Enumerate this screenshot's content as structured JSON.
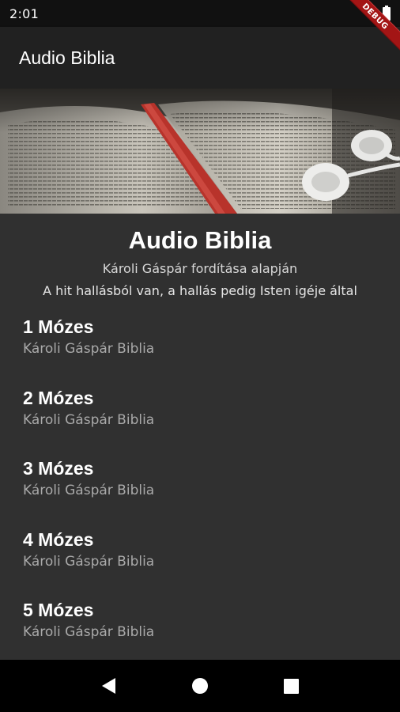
{
  "status_bar": {
    "time": "2:01",
    "battery_icon": "battery-icon"
  },
  "debug_banner": {
    "label": "DEBUG"
  },
  "app_bar": {
    "title": "Audio Biblia"
  },
  "hero": {
    "image_icon": "open-bible-with-earphones-image"
  },
  "header": {
    "title": "Audio Biblia",
    "subtitle": "Károli Gáspár fordítása alapján",
    "quote": "A hit hallásból van, a hallás pedig Isten igéje által"
  },
  "books": [
    {
      "title": "1 Mózes",
      "subtitle": "Károli Gáspár Biblia"
    },
    {
      "title": "2 Mózes",
      "subtitle": "Károli Gáspár Biblia"
    },
    {
      "title": "3 Mózes",
      "subtitle": "Károli Gáspár Biblia"
    },
    {
      "title": "4 Mózes",
      "subtitle": "Károli Gáspár Biblia"
    },
    {
      "title": "5 Mózes",
      "subtitle": "Károli Gáspár Biblia"
    }
  ],
  "nav_bar": {
    "back_icon": "back-icon",
    "home_icon": "home-icon",
    "recents_icon": "recents-icon"
  },
  "colors": {
    "background": "#303030",
    "app_bar": "#212121",
    "status_bar": "#111111",
    "subtitle_text": "#a9a9a9",
    "debug_ribbon": "#a31515"
  }
}
